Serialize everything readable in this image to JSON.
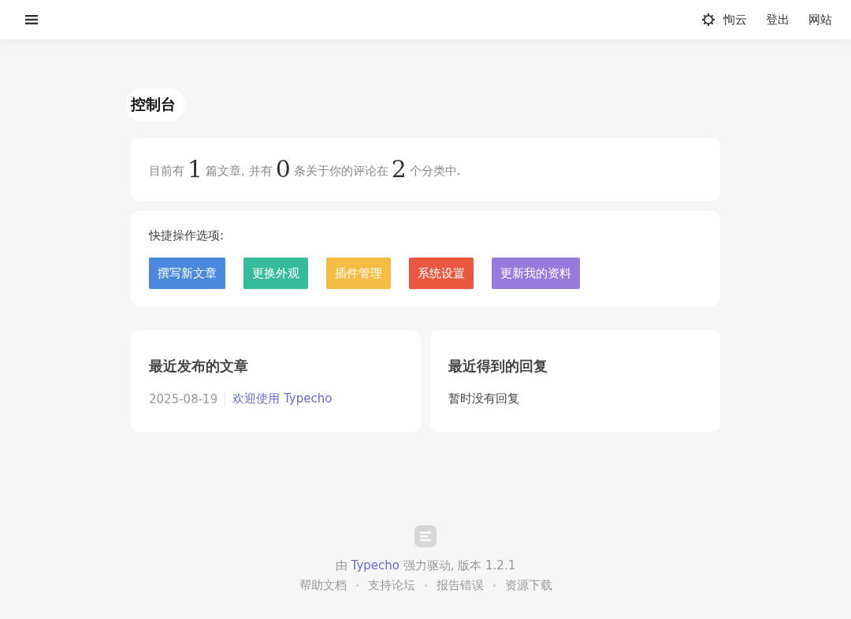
{
  "header": {
    "user": "恂云",
    "links": [
      "登出",
      "网站"
    ]
  },
  "page_title": "控制台",
  "summary": [
    {
      "kind": "text",
      "text": "目前有"
    },
    {
      "kind": "number",
      "text": "1"
    },
    {
      "kind": "text",
      "text": "篇文章, 并有"
    },
    {
      "kind": "number",
      "text": "0"
    },
    {
      "kind": "text",
      "text": "条关于你的评论在"
    },
    {
      "kind": "number",
      "text": "2"
    },
    {
      "kind": "text",
      "text": "个分类中."
    }
  ],
  "quick_actions": {
    "label": "快捷操作选项:",
    "buttons": [
      {
        "label": "撰写新文章",
        "color": "#4a89dc"
      },
      {
        "label": "更换外观",
        "color": "#37bc9b"
      },
      {
        "label": "插件管理",
        "color": "#f6bb42"
      },
      {
        "label": "系统设置",
        "color": "#e9573f"
      },
      {
        "label": "更新我的资料",
        "color": "#967adc"
      }
    ]
  },
  "recent_posts": {
    "title": "最近发布的文章",
    "items": [
      {
        "date": "2025-08-19",
        "title": "欢迎使用 Typecho"
      }
    ]
  },
  "recent_replies": {
    "title": "最近得到的回复",
    "empty": "暂时没有回复"
  },
  "footer": {
    "credit": {
      "before": "由",
      "link": "Typecho",
      "after": "强力驱动, 版本 1.2.1"
    },
    "links": [
      "帮助文档",
      "支持论坛",
      "报告错误",
      "资源下载"
    ]
  }
}
